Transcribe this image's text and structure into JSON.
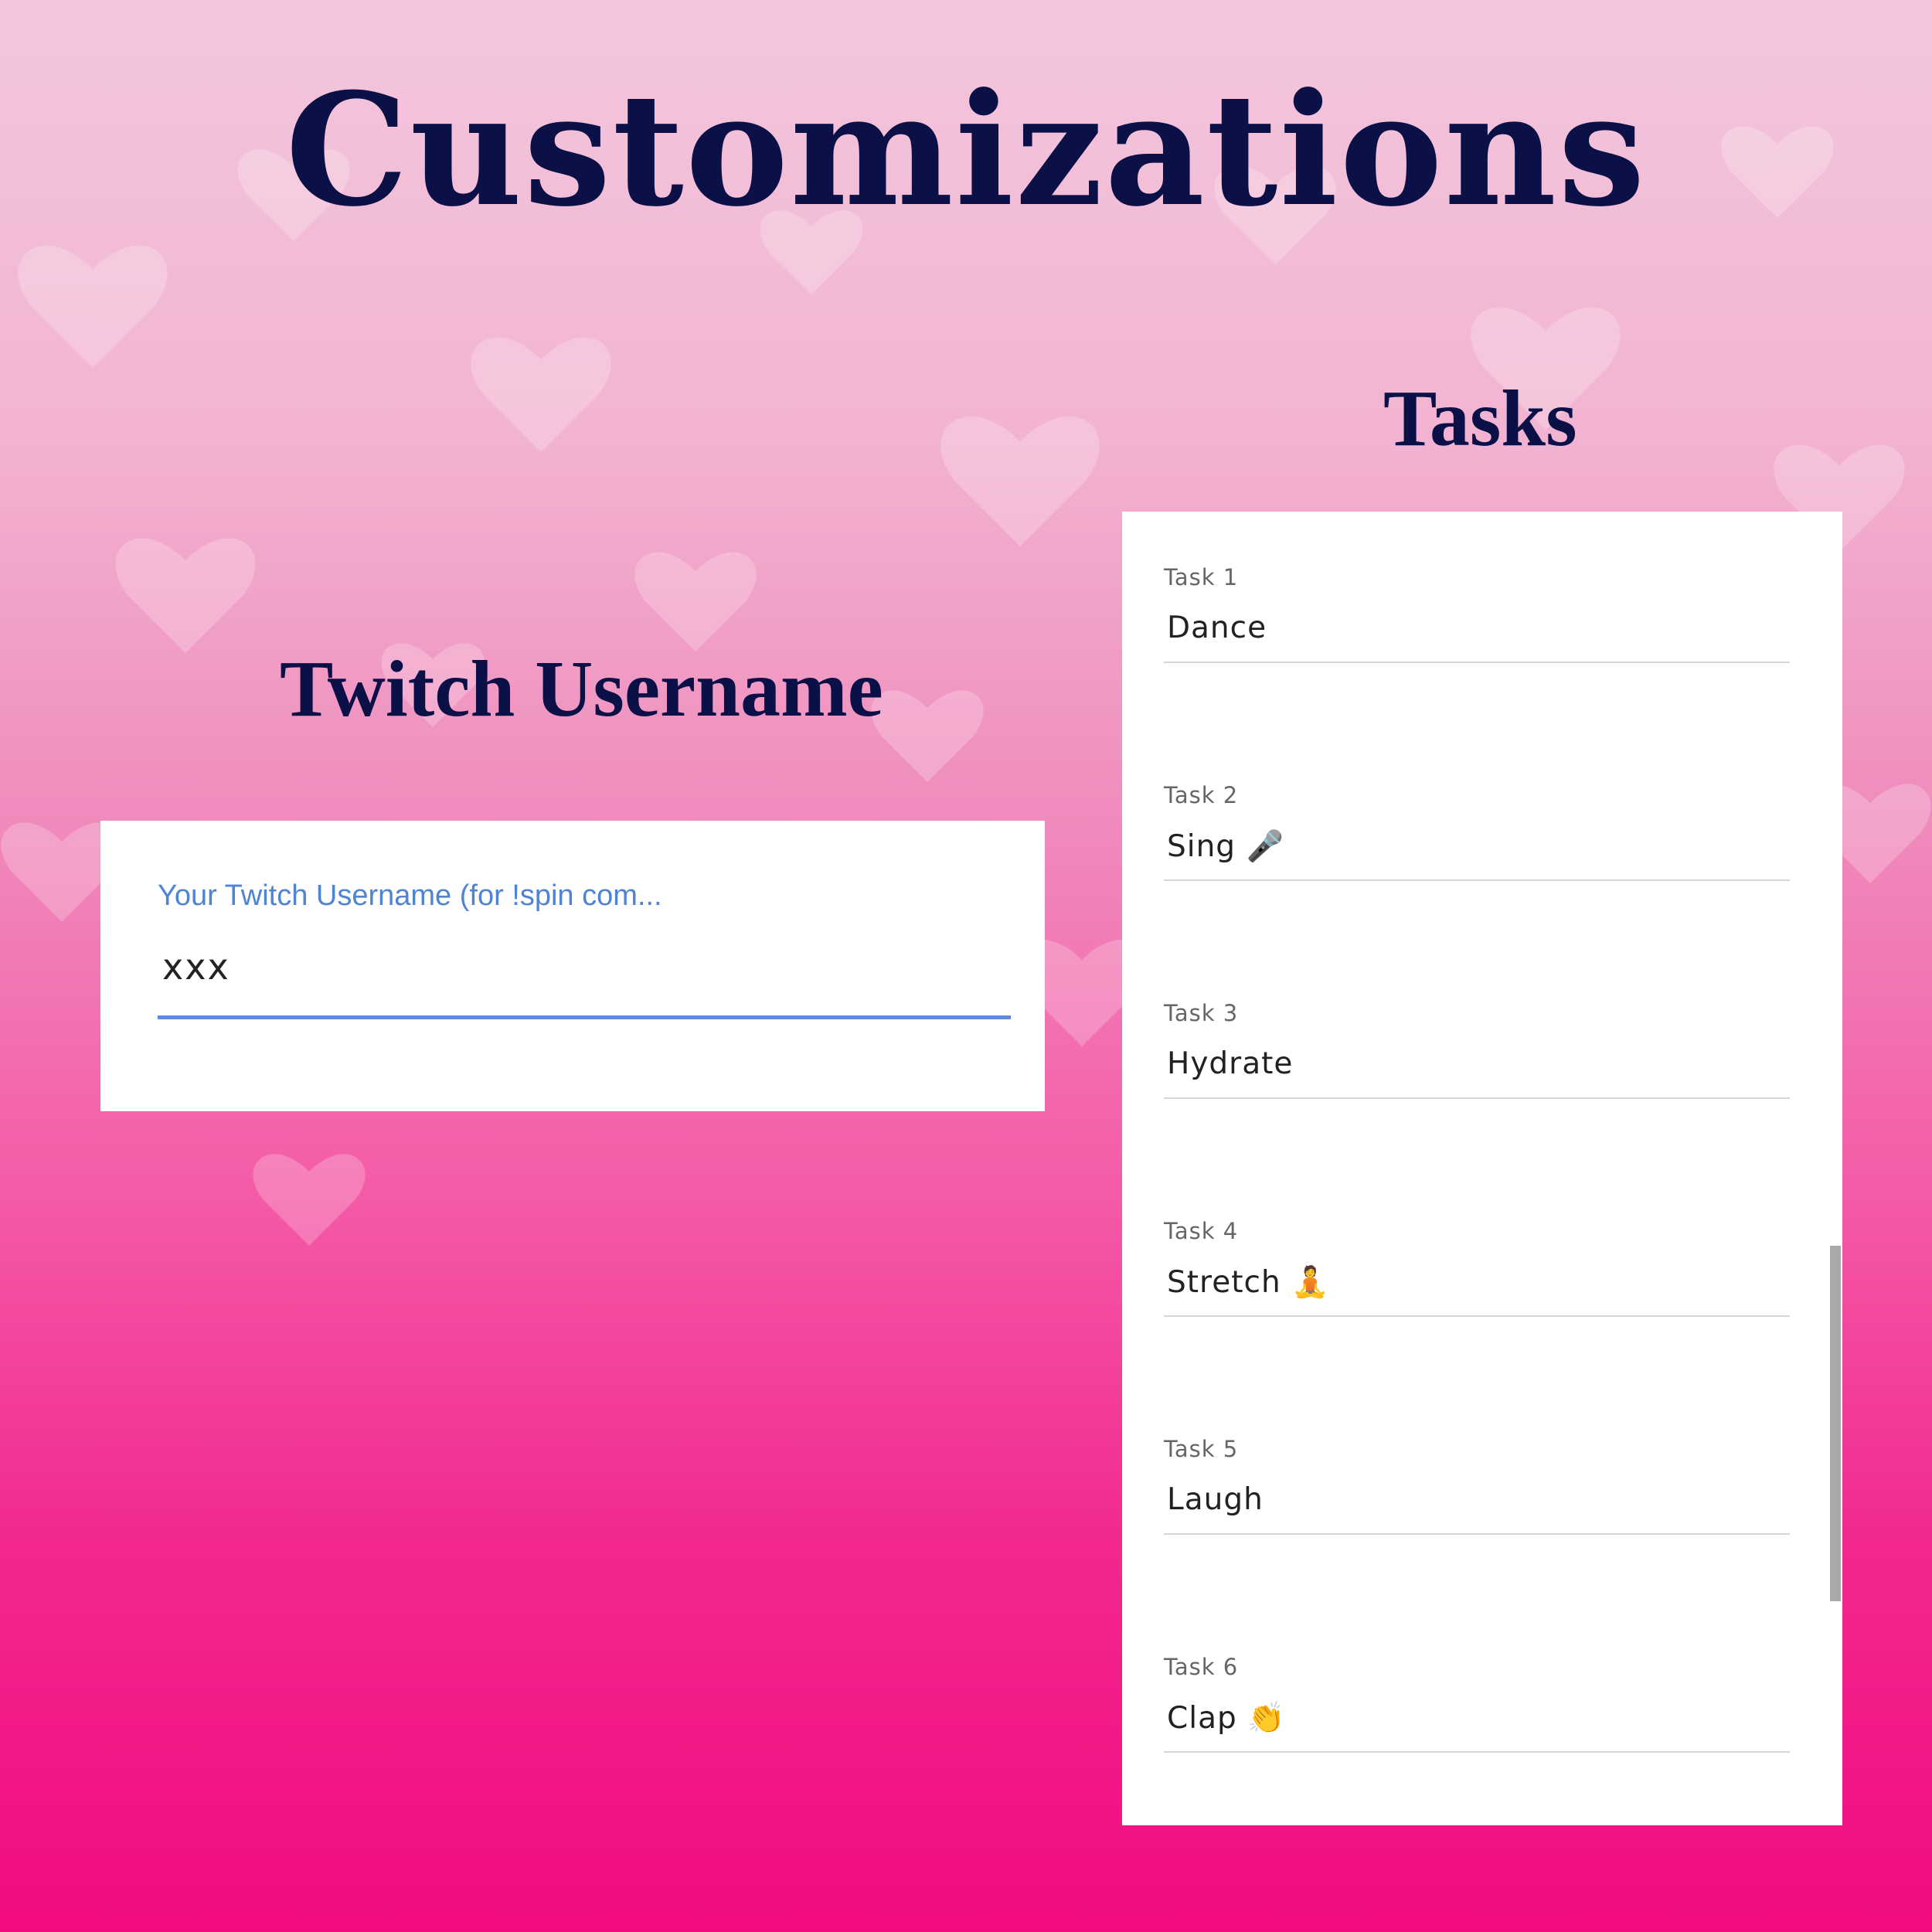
{
  "title": "Customizations",
  "tasks_heading": "Tasks",
  "username_heading": "Twitch Username",
  "username": {
    "label": "Your Twitch Username (for !spin com...",
    "value": "xxx"
  },
  "tasks": [
    {
      "label": "Task 1",
      "value": "Dance"
    },
    {
      "label": "Task 2",
      "value": "Sing 🎤"
    },
    {
      "label": "Task 3",
      "value": "Hydrate"
    },
    {
      "label": "Task 4",
      "value": "Stretch 🧘"
    },
    {
      "label": "Task 5",
      "value": "Laugh"
    },
    {
      "label": "Task 6",
      "value": "Clap 👏"
    }
  ],
  "colors": {
    "heading": "#0b1147",
    "accent": "#5e8bd8",
    "background_top": "#f3c6dd",
    "background_bottom": "#f20b80"
  }
}
